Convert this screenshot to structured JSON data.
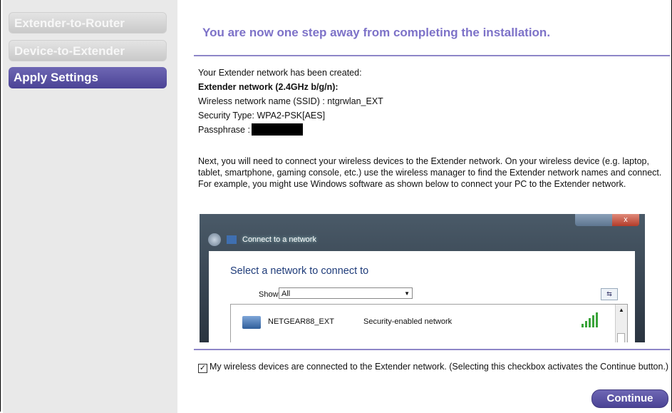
{
  "sidebar": {
    "items": [
      {
        "label": "Extender-to-Router",
        "state": "done"
      },
      {
        "label": "Device-to-Extender",
        "state": "done"
      },
      {
        "label": "Apply Settings",
        "state": "active"
      }
    ]
  },
  "main": {
    "title": "You are now one step away from completing the installation.",
    "created_text": "Your Extender network has been created:",
    "network_heading": "Extender network (2.4GHz b/g/n):",
    "ssid_line": "Wireless network name (SSID) : ntgrwlan_EXT",
    "security_line": "Security Type: WPA2-PSK[AES]",
    "passphrase_label": "Passphrase :",
    "instructions": "Next, you will need to connect your wireless devices to the Extender network. On your wireless device (e.g. laptop, tablet, smartphone, gaming console, etc.) use the wireless manager to find the Extender network names and connect. For example, you might use Windows software as shown below to connect your PC to the Extender network.",
    "checkbox_label": "My wireless devices are connected to the Extender network. (Selecting this checkbox activates the Continue button.)",
    "checkbox_checked": true,
    "continue_label": "Continue"
  },
  "example_window": {
    "title": "Connect to a network",
    "heading": "Select a network to connect to",
    "show_label": "Show",
    "show_value": "All",
    "network_ssid": "NETGEAR88_EXT",
    "network_security": "Security-enabled network",
    "close_glyph": "x"
  },
  "colors": {
    "accent": "#5a52a6",
    "title": "#7d72c8",
    "sidebar_bg": "#e9e9e9"
  }
}
